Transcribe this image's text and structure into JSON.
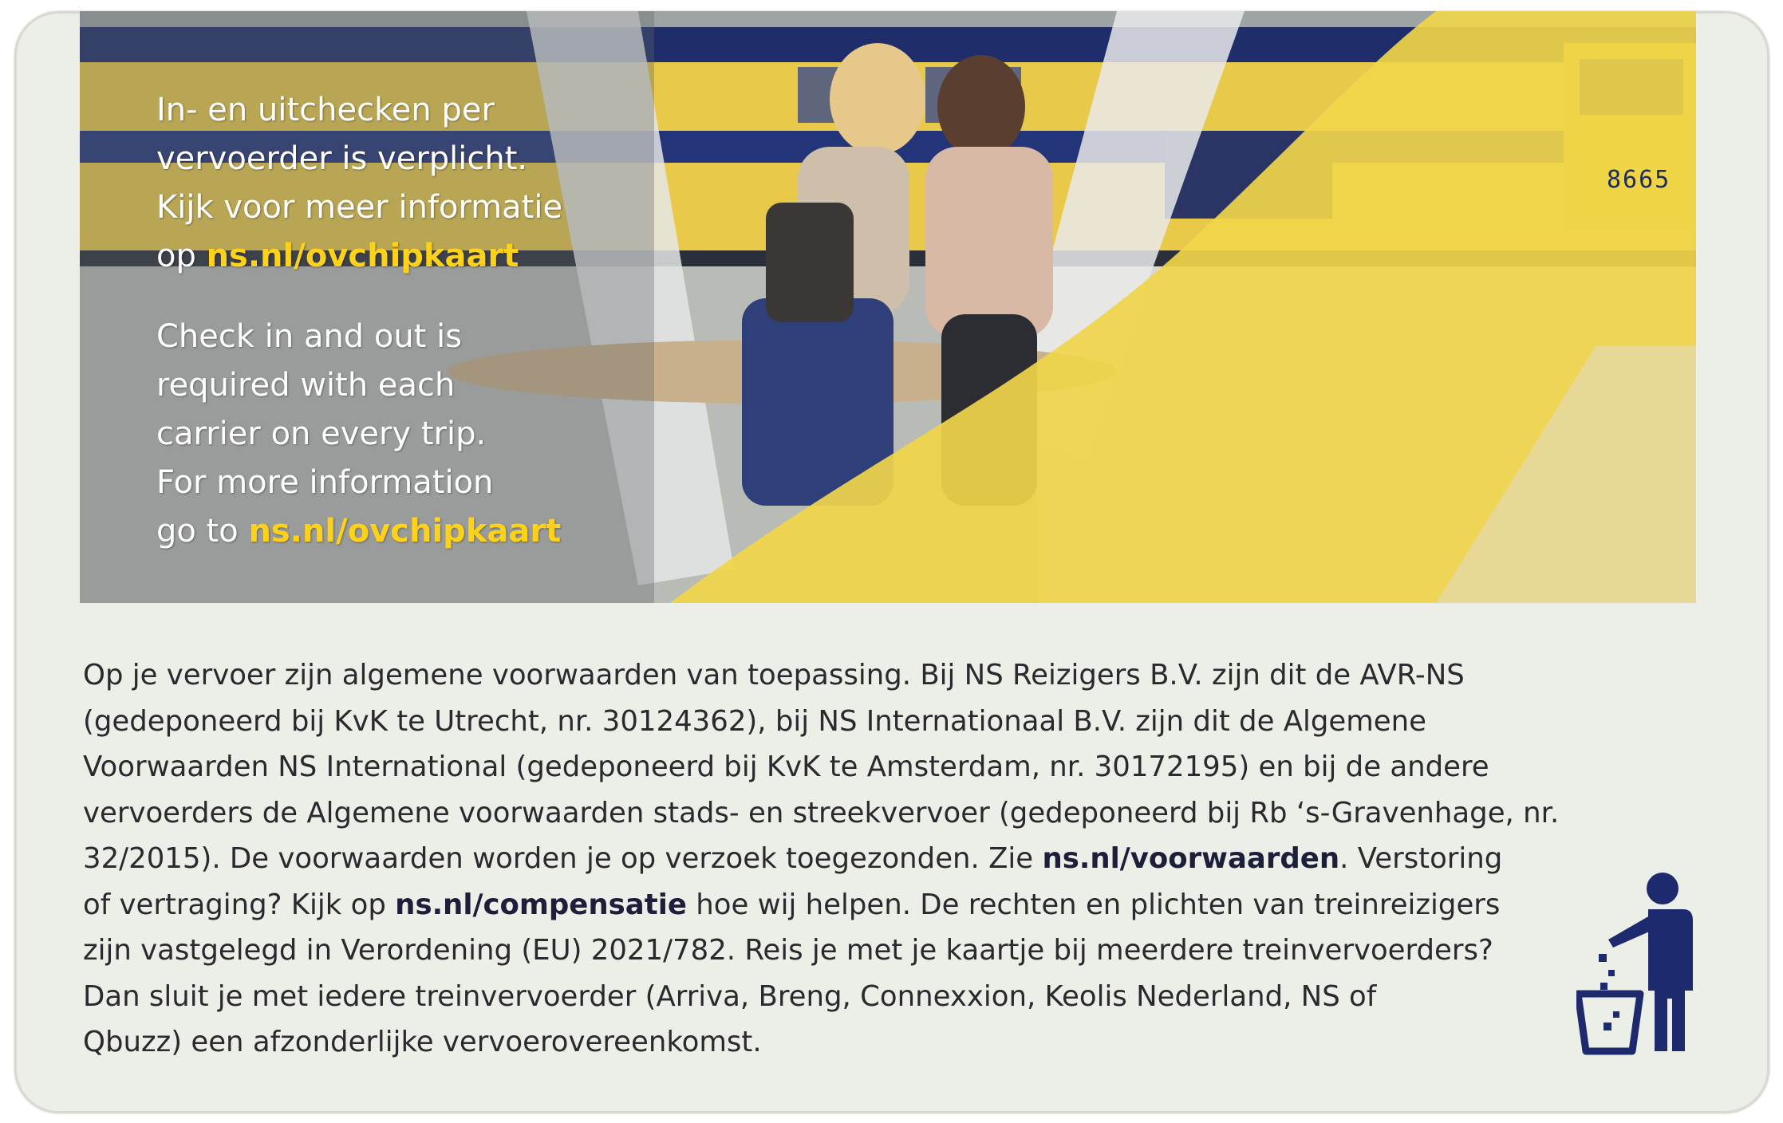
{
  "photo_panel": {
    "dutch_lines": [
      "In- en uitchecken per",
      "vervoerder is verplicht.",
      "Kijk voor meer informatie"
    ],
    "dutch_link_prefix": "op ",
    "dutch_link": "ns.nl/ovchipkaart",
    "english_lines": [
      "Check in and out is",
      "required with each",
      "carrier on every trip.",
      "For more information"
    ],
    "english_link_prefix": "go to ",
    "english_link": "ns.nl/ovchipkaart",
    "train_number": "8665"
  },
  "terms": {
    "line1": "Op je vervoer zijn algemene voorwaarden van toepassing. Bij NS Reizigers B.V. zijn dit de AVR-NS",
    "line2": "(gedeponeerd bij KvK te Utrecht, nr. 30124362), bij NS Internationaal B.V. zijn dit de Algemene",
    "line3": "Voorwaarden NS International (gedeponeerd bij KvK te Amsterdam, nr. 30172195) en bij de andere",
    "line4": "vervoerders de Algemene voorwaarden stads- en streekvervoer (gedeponeerd bij Rb ‘s-Gravenhage, nr.",
    "line5_pre": "32/2015). De voorwaarden worden je op verzoek toegezonden. Zie ",
    "line5_link": "ns.nl/voorwaarden",
    "line5_post": ". Verstoring",
    "line6_pre": "of vertraging? Kijk op ",
    "line6_link": "ns.nl/compensatie",
    "line6_post": " hoe wij helpen. De rechten en plichten van treinreizigers",
    "line7": "zijn vastgelegd in Verordening (EU) 2021/782. Reis je met je kaartje bij meerdere treinvervoerders?",
    "line8": "Dan sluit je met iedere treinvervoerder (Arriva, Breng, Connexxion, Keolis Nederland, NS of",
    "line9": "Qbuzz) een afzonderlijke vervoerovereenkomst."
  },
  "icons": {
    "bin_icon": "tidyman-litter-bin-icon"
  },
  "colors": {
    "ns_yellow": "#ffd21a",
    "ns_blue": "#1d2b6e",
    "card_bg": "#eceee8"
  }
}
